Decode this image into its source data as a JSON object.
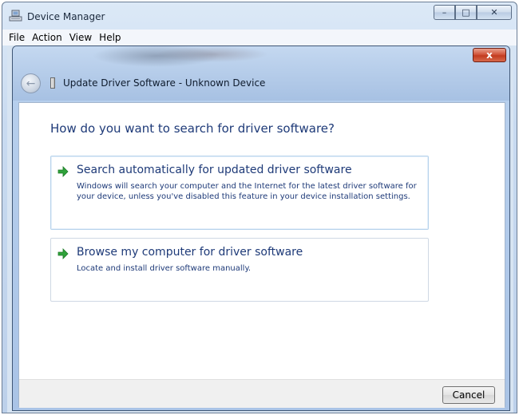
{
  "device_manager": {
    "title": "Device Manager",
    "menu": [
      "File",
      "Action",
      "View",
      "Help"
    ],
    "caption_buttons": {
      "minimize": "minimize-icon",
      "maximize": "maximize-icon",
      "close": "close-icon"
    }
  },
  "wizard": {
    "title": "Update Driver Software - Unknown Device",
    "question": "How do you want to search for driver software?",
    "options": [
      {
        "title": "Search automatically for updated driver software",
        "description": "Windows will search your computer and the Internet for the latest driver software for your device, unless you've disabled this feature in your device installation settings."
      },
      {
        "title": "Browse my computer for driver software",
        "description": "Locate and install driver software manually."
      }
    ],
    "cancel_label": "Cancel",
    "close_glyph": "x"
  },
  "colors": {
    "link_blue": "#1e3a78",
    "arrow_green": "#2fa23a",
    "close_red": "#c23c20"
  }
}
